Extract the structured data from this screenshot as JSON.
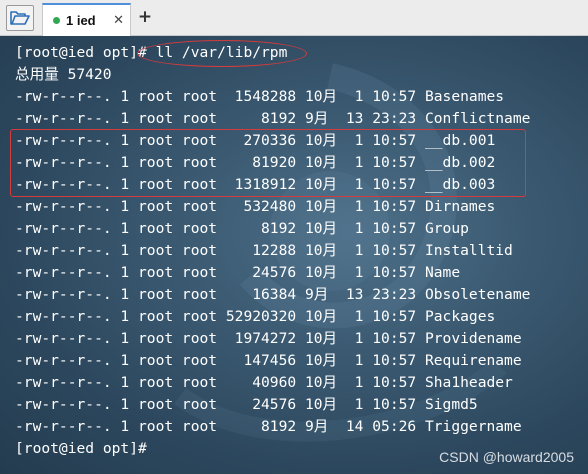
{
  "tabbar": {
    "open_icon": "folder-open-icon",
    "tab_label": "1 ied",
    "close_glyph": "✕",
    "add_glyph": "+",
    "active_color": "#4f8ed8",
    "status_dot_color": "#33a852"
  },
  "terminal": {
    "lines": [
      "[root@ied opt]# ll /var/lib/rpm",
      "总用量 57420",
      "-rw-r--r--. 1 root root  1548288 10月  1 10:57 Basenames",
      "-rw-r--r--. 1 root root     8192 9月  13 23:23 Conflictname",
      "-rw-r--r--. 1 root root   270336 10月  1 10:57 __db.001",
      "-rw-r--r--. 1 root root    81920 10月  1 10:57 __db.002",
      "-rw-r--r--. 1 root root  1318912 10月  1 10:57 __db.003",
      "-rw-r--r--. 1 root root   532480 10月  1 10:57 Dirnames",
      "-rw-r--r--. 1 root root     8192 10月  1 10:57 Group",
      "-rw-r--r--. 1 root root    12288 10月  1 10:57 Installtid",
      "-rw-r--r--. 1 root root    24576 10月  1 10:57 Name",
      "-rw-r--r--. 1 root root    16384 9月  13 23:23 Obsoletename",
      "-rw-r--r--. 1 root root 52920320 10月  1 10:57 Packages",
      "-rw-r--r--. 1 root root  1974272 10月  1 10:57 Providename",
      "-rw-r--r--. 1 root root   147456 10月  1 10:57 Requirename",
      "-rw-r--r--. 1 root root    40960 10月  1 10:57 Sha1header",
      "-rw-r--r--. 1 root root    24576 10月  1 10:57 Sigmd5",
      "-rw-r--r--. 1 root root     8192 9月  14 05:26 Triggername",
      "[root@ied opt]#"
    ],
    "annotation_color": "#d63b3b"
  },
  "watermark": "CSDN @howard2005"
}
